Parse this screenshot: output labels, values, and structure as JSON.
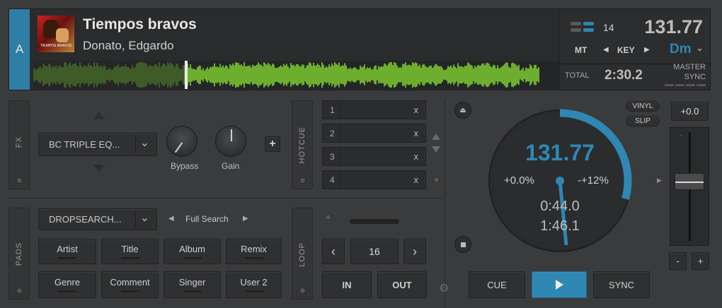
{
  "deck": {
    "letter": "A",
    "track_title": "Tiempos bravos",
    "track_artist": "Donato, Edgardo",
    "bpm": "131.77",
    "layout_number": "14",
    "mt_label": "MT",
    "key_label": "KEY",
    "key_value": "Dm",
    "total_label": "TOTAL",
    "total_time": "2:30.2",
    "master_label": "MASTER",
    "sync_label": "SYNC",
    "album_art_text": "TIEMPOS BRAVOS"
  },
  "fx": {
    "section_label": "FX",
    "effect_name": "BC TRIPLE EQ...",
    "knob1_label": "Bypass",
    "knob2_label": "Gain",
    "add_label": "+"
  },
  "hotcue": {
    "section_label": "HOTCUE",
    "slots": [
      {
        "num": "1",
        "x": "x"
      },
      {
        "num": "2",
        "x": "x"
      },
      {
        "num": "3",
        "x": "x"
      },
      {
        "num": "4",
        "x": "x"
      }
    ]
  },
  "pads": {
    "section_label": "PADS",
    "dropdown": "DROPSEARCH...",
    "mode": "Full Search",
    "buttons": [
      "Artist",
      "Title",
      "Album",
      "Remix",
      "Genre",
      "Comment",
      "Singer",
      "User 2"
    ]
  },
  "loop": {
    "section_label": "LOOP",
    "size": "16",
    "in_label": "IN",
    "out_label": "OUT"
  },
  "jog": {
    "bpm": "131.77",
    "pitch_left": "+0.0%",
    "pitch_right": "-+12%",
    "elapsed": "0:44.0",
    "remaining": "1:46.1",
    "vinyl_label": "VINYL",
    "slip_label": "SLIP"
  },
  "pitch": {
    "value": "+0.0",
    "minus": "-",
    "plus": "+"
  },
  "transport": {
    "cue_label": "CUE",
    "sync_label": "SYNC"
  },
  "colors": {
    "accent": "#2f87b3",
    "waveform": "#8ee832"
  }
}
